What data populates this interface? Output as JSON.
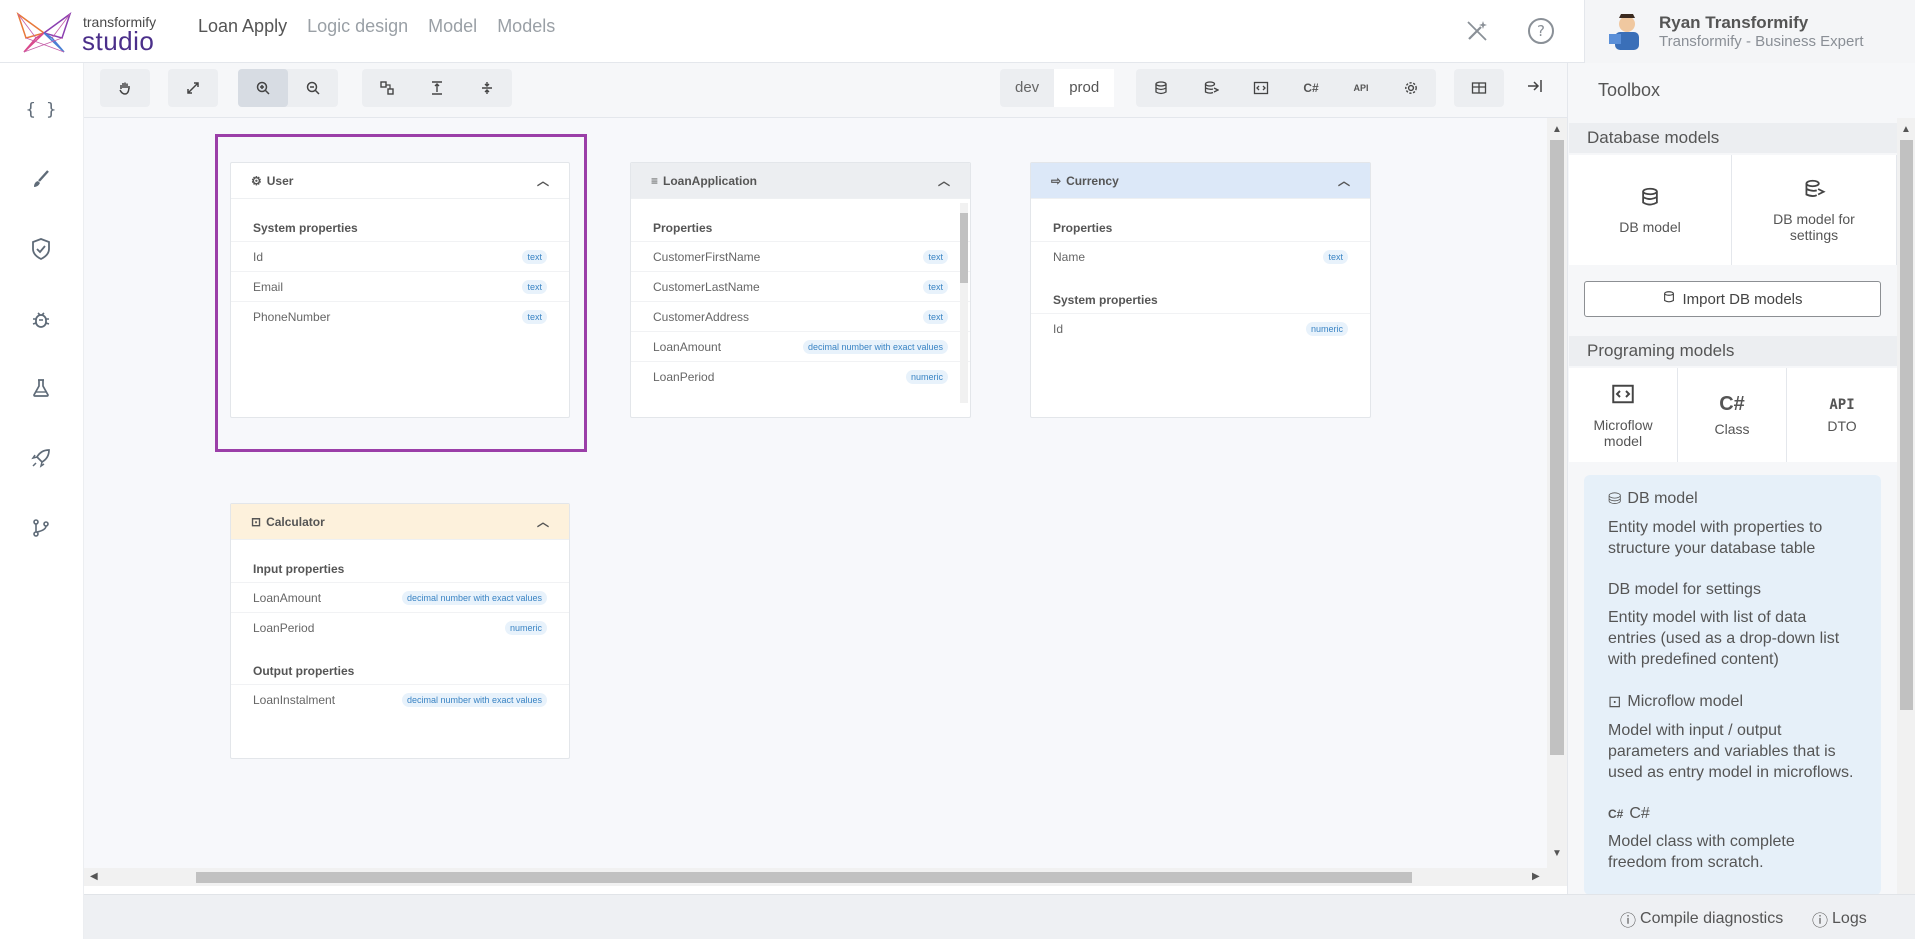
{
  "brand": {
    "top": "transformify",
    "main": "studio"
  },
  "nav": [
    {
      "label": "Loan Apply",
      "active": true
    },
    {
      "label": "Logic design",
      "active": false
    },
    {
      "label": "Model",
      "active": false
    },
    {
      "label": "Models",
      "active": false
    }
  ],
  "user": {
    "name": "Ryan Transformify",
    "role": "Transformify - Business Expert"
  },
  "environment": {
    "options": [
      "dev",
      "prod"
    ],
    "selected": "prod"
  },
  "toolbar": {
    "csharp": "C#",
    "api": "API"
  },
  "cards": {
    "user": {
      "title": "User",
      "sections": [
        {
          "title": "System properties",
          "props": [
            {
              "name": "Id",
              "type": "text"
            },
            {
              "name": "Email",
              "type": "text"
            },
            {
              "name": "PhoneNumber",
              "type": "text"
            }
          ]
        }
      ]
    },
    "loan": {
      "title": "LoanApplication",
      "sections": [
        {
          "title": "Properties",
          "props": [
            {
              "name": "CustomerFirstName",
              "type": "text"
            },
            {
              "name": "CustomerLastName",
              "type": "text"
            },
            {
              "name": "CustomerAddress",
              "type": "text"
            },
            {
              "name": "LoanAmount",
              "type": "decimal number with exact values"
            },
            {
              "name": "LoanPeriod",
              "type": "numeric"
            }
          ]
        }
      ]
    },
    "currency": {
      "title": "Currency",
      "sections": [
        {
          "title": "Properties",
          "props": [
            {
              "name": "Name",
              "type": "text"
            }
          ]
        },
        {
          "title": "System properties",
          "props": [
            {
              "name": "Id",
              "type": "numeric"
            }
          ]
        }
      ]
    },
    "calculator": {
      "title": "Calculator",
      "sections": [
        {
          "title": "Input properties",
          "props": [
            {
              "name": "LoanAmount",
              "type": "decimal number with exact values"
            },
            {
              "name": "LoanPeriod",
              "type": "numeric"
            }
          ]
        },
        {
          "title": "Output properties",
          "props": [
            {
              "name": "LoanInstalment",
              "type": "decimal number with exact values"
            }
          ]
        }
      ]
    }
  },
  "toolbox": {
    "title": "Toolbox",
    "db_section": "Database models",
    "db_model": "DB model",
    "db_settings": "DB model for settings",
    "import": "Import DB models",
    "prog_section": "Programing models",
    "microflow": "Microflow model",
    "class": "Class",
    "dto": "DTO",
    "dto_icon": "API",
    "csharp_icon": "C#",
    "info": [
      {
        "title": "DB model",
        "text": "Entity model with properties to structure your database table"
      },
      {
        "title": "DB model for settings",
        "text": "Entity model with list of data entries (used as a drop-down list with predefined content)"
      },
      {
        "title": "Microflow model",
        "text": "Model with input / output parameters and variables that is used as entry model in microflows."
      },
      {
        "title": "C#",
        "text": "Model class with complete freedom from scratch."
      }
    ]
  },
  "footer": {
    "compile": "Compile diagnostics",
    "logs": "Logs"
  },
  "colors": {
    "accent": "#4b2f8a",
    "highlight": "#9b3fa8",
    "badge": "#3a84c4"
  }
}
